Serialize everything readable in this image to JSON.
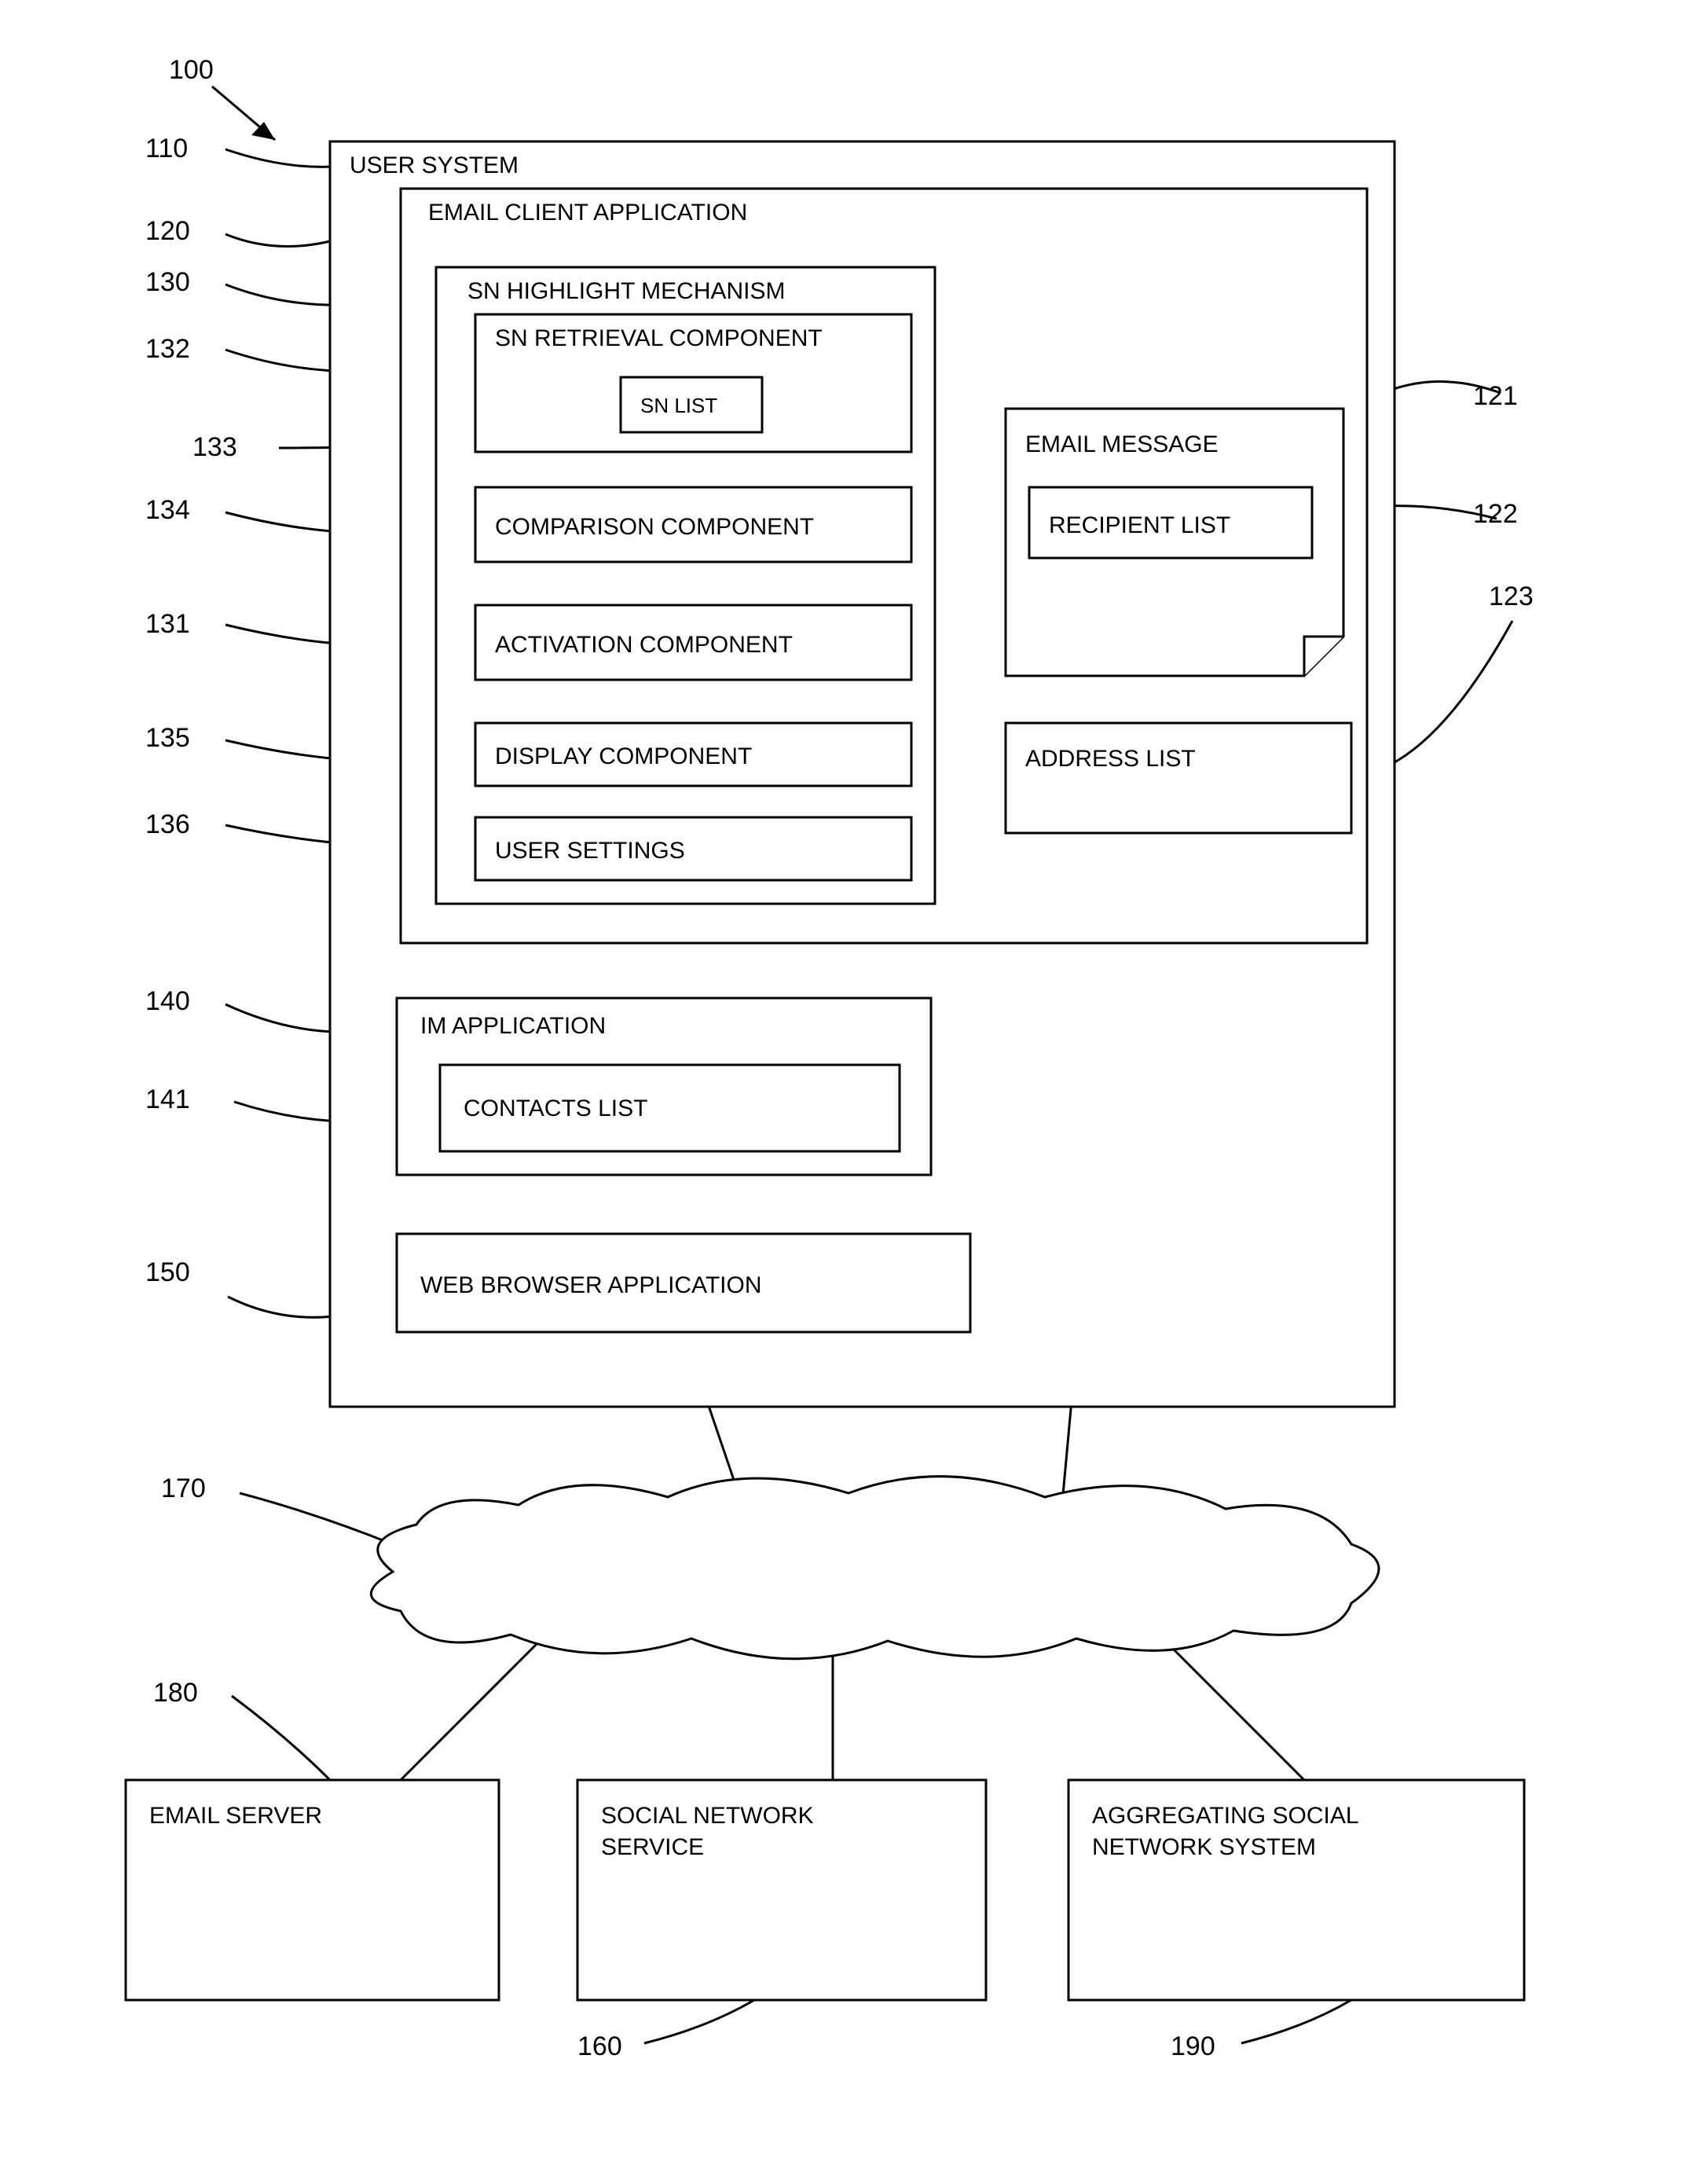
{
  "refs": {
    "r100": "100",
    "r110": "110",
    "r120": "120",
    "r130": "130",
    "r132": "132",
    "r133": "133",
    "r134": "134",
    "r131": "131",
    "r135": "135",
    "r136": "136",
    "r140": "140",
    "r141": "141",
    "r150": "150",
    "r170": "170",
    "r180": "180",
    "r121": "121",
    "r122": "122",
    "r123": "123",
    "r160": "160",
    "r190": "190"
  },
  "labels": {
    "user_system": "USER SYSTEM",
    "email_client": "EMAIL CLIENT APPLICATION",
    "sn_highlight": "SN HIGHLIGHT MECHANISM",
    "sn_retrieval": "SN RETRIEVAL COMPONENT",
    "sn_list": "SN LIST",
    "comparison": "COMPARISON COMPONENT",
    "activation": "ACTIVATION COMPONENT",
    "display": "DISPLAY COMPONENT",
    "user_settings": "USER SETTINGS",
    "email_message": "EMAIL MESSAGE",
    "recipient_list": "RECIPIENT LIST",
    "address_list": "ADDRESS LIST",
    "im_app": "IM APPLICATION",
    "contacts_list": "CONTACTS LIST",
    "web_browser": "WEB BROWSER APPLICATION",
    "email_server": "EMAIL SERVER",
    "social_network_service": "SOCIAL NETWORK\nSERVICE",
    "aggregating": "AGGREGATING SOCIAL\nNETWORK SYSTEM"
  }
}
